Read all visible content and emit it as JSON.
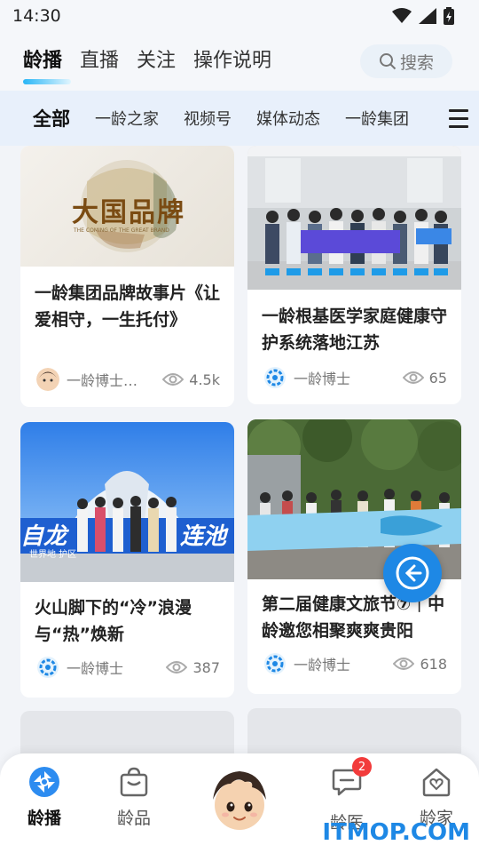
{
  "status_bar": {
    "time": "14:30"
  },
  "header": {
    "tabs": [
      {
        "label": "龄播",
        "active": true
      },
      {
        "label": "直播"
      },
      {
        "label": "关注"
      },
      {
        "label": "操作说明"
      }
    ],
    "search_label": "搜索"
  },
  "categories": [
    {
      "label": "全部",
      "active": true
    },
    {
      "label": "一龄之家"
    },
    {
      "label": "视频号"
    },
    {
      "label": "媒体动态"
    },
    {
      "label": "一龄集团"
    }
  ],
  "feed": [
    {
      "title": "一龄集团品牌故事片《让爱相守，一生托付》",
      "author": "一龄博士…",
      "views": "4.5k",
      "thumb_text": "大国品牌",
      "thumb_sub": "THE COMING OF THE GREAT BRAND"
    },
    {
      "title": "一龄根基医学家庭健康守护系统落地江苏",
      "author": "一龄博士",
      "views": "65"
    },
    {
      "title": "火山脚下的“冷”浪漫与“热”焕新",
      "author": "一龄博士",
      "views": "387",
      "thumb_left": "自龙",
      "thumb_right": "连池",
      "thumb_sub": "世界地  护区"
    },
    {
      "title": "第二届健康文旅节⑦｜中龄邀您相聚爽爽贵阳",
      "author": "一龄博士",
      "views": "618"
    }
  ],
  "bottom_nav": [
    {
      "label": "龄播",
      "icon": "aperture-icon",
      "active": true
    },
    {
      "label": "龄品",
      "icon": "shopping-bag-icon"
    },
    {
      "label": "",
      "icon": "mascot-avatar"
    },
    {
      "label": "龄医",
      "icon": "chat-icon",
      "badge": "2"
    },
    {
      "label": "龄家",
      "icon": "home-heart-icon"
    }
  ],
  "watermark": "ITMOP.COM",
  "colors": {
    "accent": "#1e88e5",
    "badge": "#f23b3b"
  }
}
